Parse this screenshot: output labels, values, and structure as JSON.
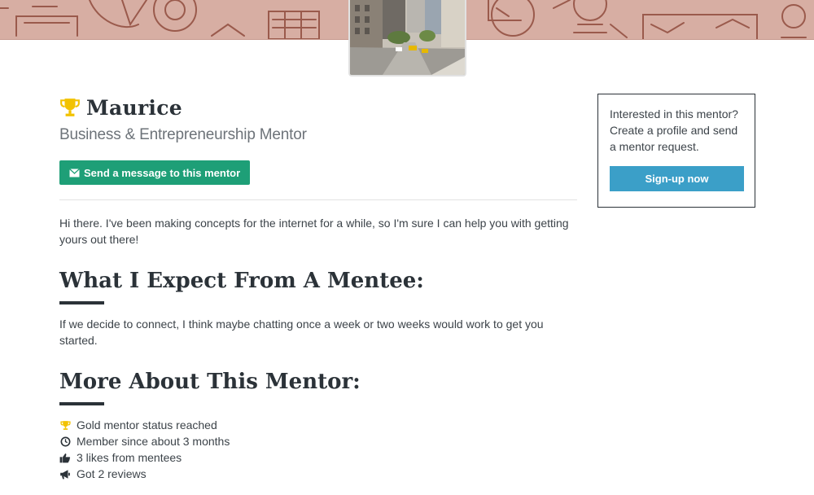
{
  "mentor": {
    "name": "Maurice",
    "title": "Business & Entrepreneurship Mentor",
    "message_button": "Send a message to this mentor",
    "bio": "Hi there. I've been making concepts for the internet for a while, so I'm sure I can help you with getting yours out there!"
  },
  "sections": {
    "expect_heading": "What I Expect From A Mentee:",
    "expect_text": "If we decide to connect, I think maybe chatting once a week or two weeks would work to get you started.",
    "more_heading": "More About This Mentor:",
    "stats": [
      {
        "icon": "trophy-icon",
        "text": "Gold mentor status reached"
      },
      {
        "icon": "clock-icon",
        "text": "Member since about 3 months"
      },
      {
        "icon": "thumbs-up-icon",
        "text": "3 likes from mentees"
      },
      {
        "icon": "megaphone-icon",
        "text": "Got 2 reviews"
      }
    ]
  },
  "sidebar": {
    "cta_text": "Interested in this mentor? Create a profile and send a mentor request.",
    "signup_button": "Sign-up now"
  },
  "colors": {
    "banner": "#d7aea3",
    "message_button": "#1e9f77",
    "signup_button": "#3b9fc8",
    "trophy": "#f2c200",
    "heading": "#2b3238"
  }
}
